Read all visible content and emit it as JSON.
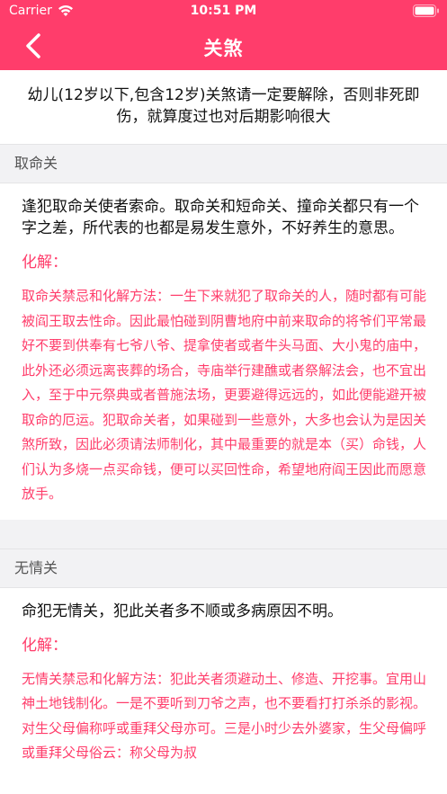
{
  "status_bar": {
    "carrier": "Carrier",
    "time": "10:51 PM"
  },
  "nav": {
    "title": "关煞"
  },
  "intro": "幼儿(12岁以下,包含12岁)关煞请一定要解除，否则非死即伤，就算度过也对后期影响很大",
  "sections": [
    {
      "title": "取命关",
      "description": "逢犯取命关使者索命。取命关和短命关、撞命关都只有一个字之差，所代表的也都是易发生意外，不好养生的意思。",
      "resolve_label": "化解：",
      "resolve_text": "取命关禁忌和化解方法：一生下来就犯了取命关的人，随时都有可能被阎王取去性命。因此最怕碰到阴曹地府中前来取命的将爷们平常最好不要到供奉有七爷八爷、提拿使者或者牛头马面、大小鬼的庙中，此外还必须远离丧葬的场合，寺庙举行建醮或者祭解法会，也不宜出入，至于中元祭典或者普施法场，更要避得远远的，如此便能避开被取命的厄运。犯取命关者，如果碰到一些意外，大多也会认为是因关煞所致，因此必须请法师制化，其中最重要的就是本（买）命钱，人们认为多烧一点买命钱，便可以买回性命，希望地府阎王因此而愿意放手。"
    },
    {
      "title": "无情关",
      "description": "命犯无情关，犯此关者多不顺或多病原因不明。",
      "resolve_label": "化解：",
      "resolve_text": "无情关禁忌和化解方法：犯此关者须避动土、修造、开挖事。宜用山神土地钱制化。一是不要听到刀爷之声，也不要看打打杀杀的影视。对生父母偏称呼或重拜父母亦可。三是小时少去外婆家，生父母偏呼或重拜父母俗云：称父母为叔"
    }
  ],
  "colors": {
    "accent": "#ff3d6b",
    "section_bg": "#f2f2f4"
  }
}
